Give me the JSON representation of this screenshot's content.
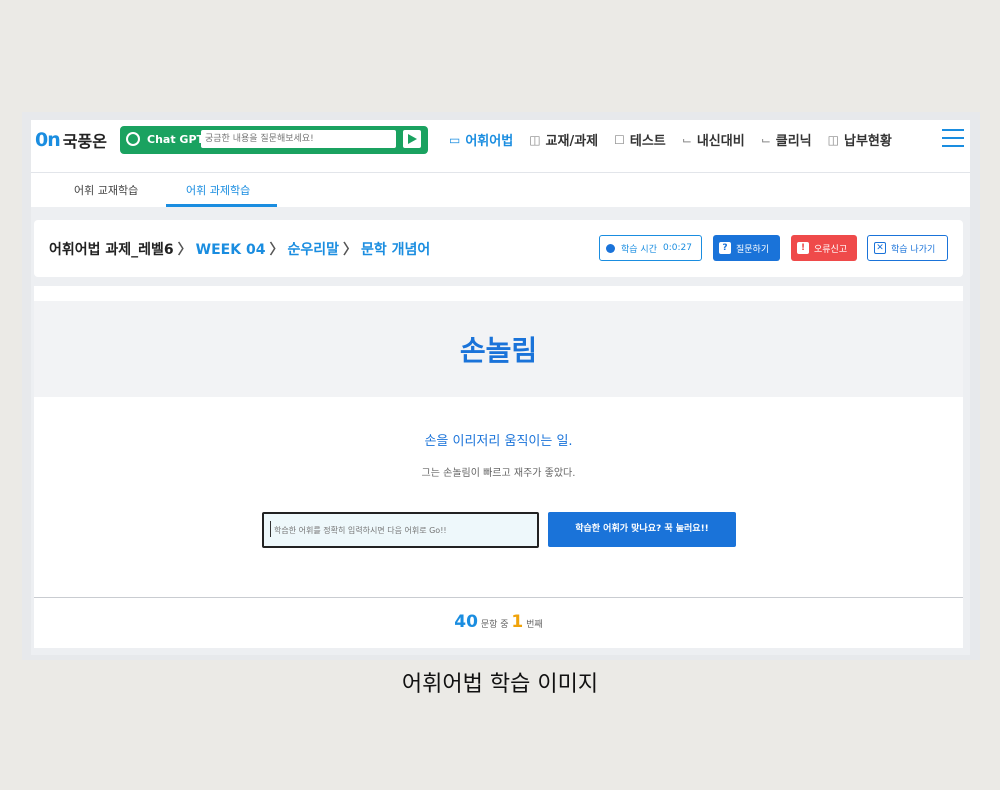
{
  "logo": {
    "mark": "0n",
    "text": "국풍온"
  },
  "gpt": {
    "label": "Chat GPT",
    "placeholder": "궁금한 내용을 질문해보세요!"
  },
  "menu": [
    {
      "icon": "vocab-icon",
      "label": "어휘어법",
      "active": true
    },
    {
      "icon": "book-icon",
      "label": "교재/과제"
    },
    {
      "icon": "edit-icon",
      "label": "테스트"
    },
    {
      "icon": "chart-icon",
      "label": "내신대비"
    },
    {
      "icon": "chart-icon",
      "label": "클리닉"
    },
    {
      "icon": "book-icon",
      "label": "납부현황"
    }
  ],
  "subtabs": [
    "어휘 교재학습",
    "어휘 과제학습"
  ],
  "breadcrumb": {
    "part1": "어휘어법 과제_레벨6",
    "part2": "WEEK 04",
    "part3": "순우리말",
    "part4": "문학 개념어"
  },
  "buttons": {
    "time_label": "학습 시간",
    "time_value": "0:0:27",
    "question": "질문하기",
    "error": "오류신고",
    "exit": "학습 나가기"
  },
  "word": "손놀림",
  "meaning": "손을 이리저리 움직이는 일.",
  "example": "그는 손놀림이 빠르고 재주가 좋았다.",
  "answer": {
    "placeholder": "학습한 어휘를 정확히 입력하시면 다음 어휘로 Go!!"
  },
  "submit_label": "학습한 어휘가 맞나요? 꾹 눌러요!!",
  "progress": {
    "total": "40",
    "mid": "문항 중",
    "current": "1",
    "suffix": "번째"
  },
  "caption": "어휘어법 학습 이미지",
  "colors": {
    "accent": "#1a8de0",
    "gpt": "#1aa260",
    "error": "#ef4a4a",
    "current": "#f0a30a"
  }
}
